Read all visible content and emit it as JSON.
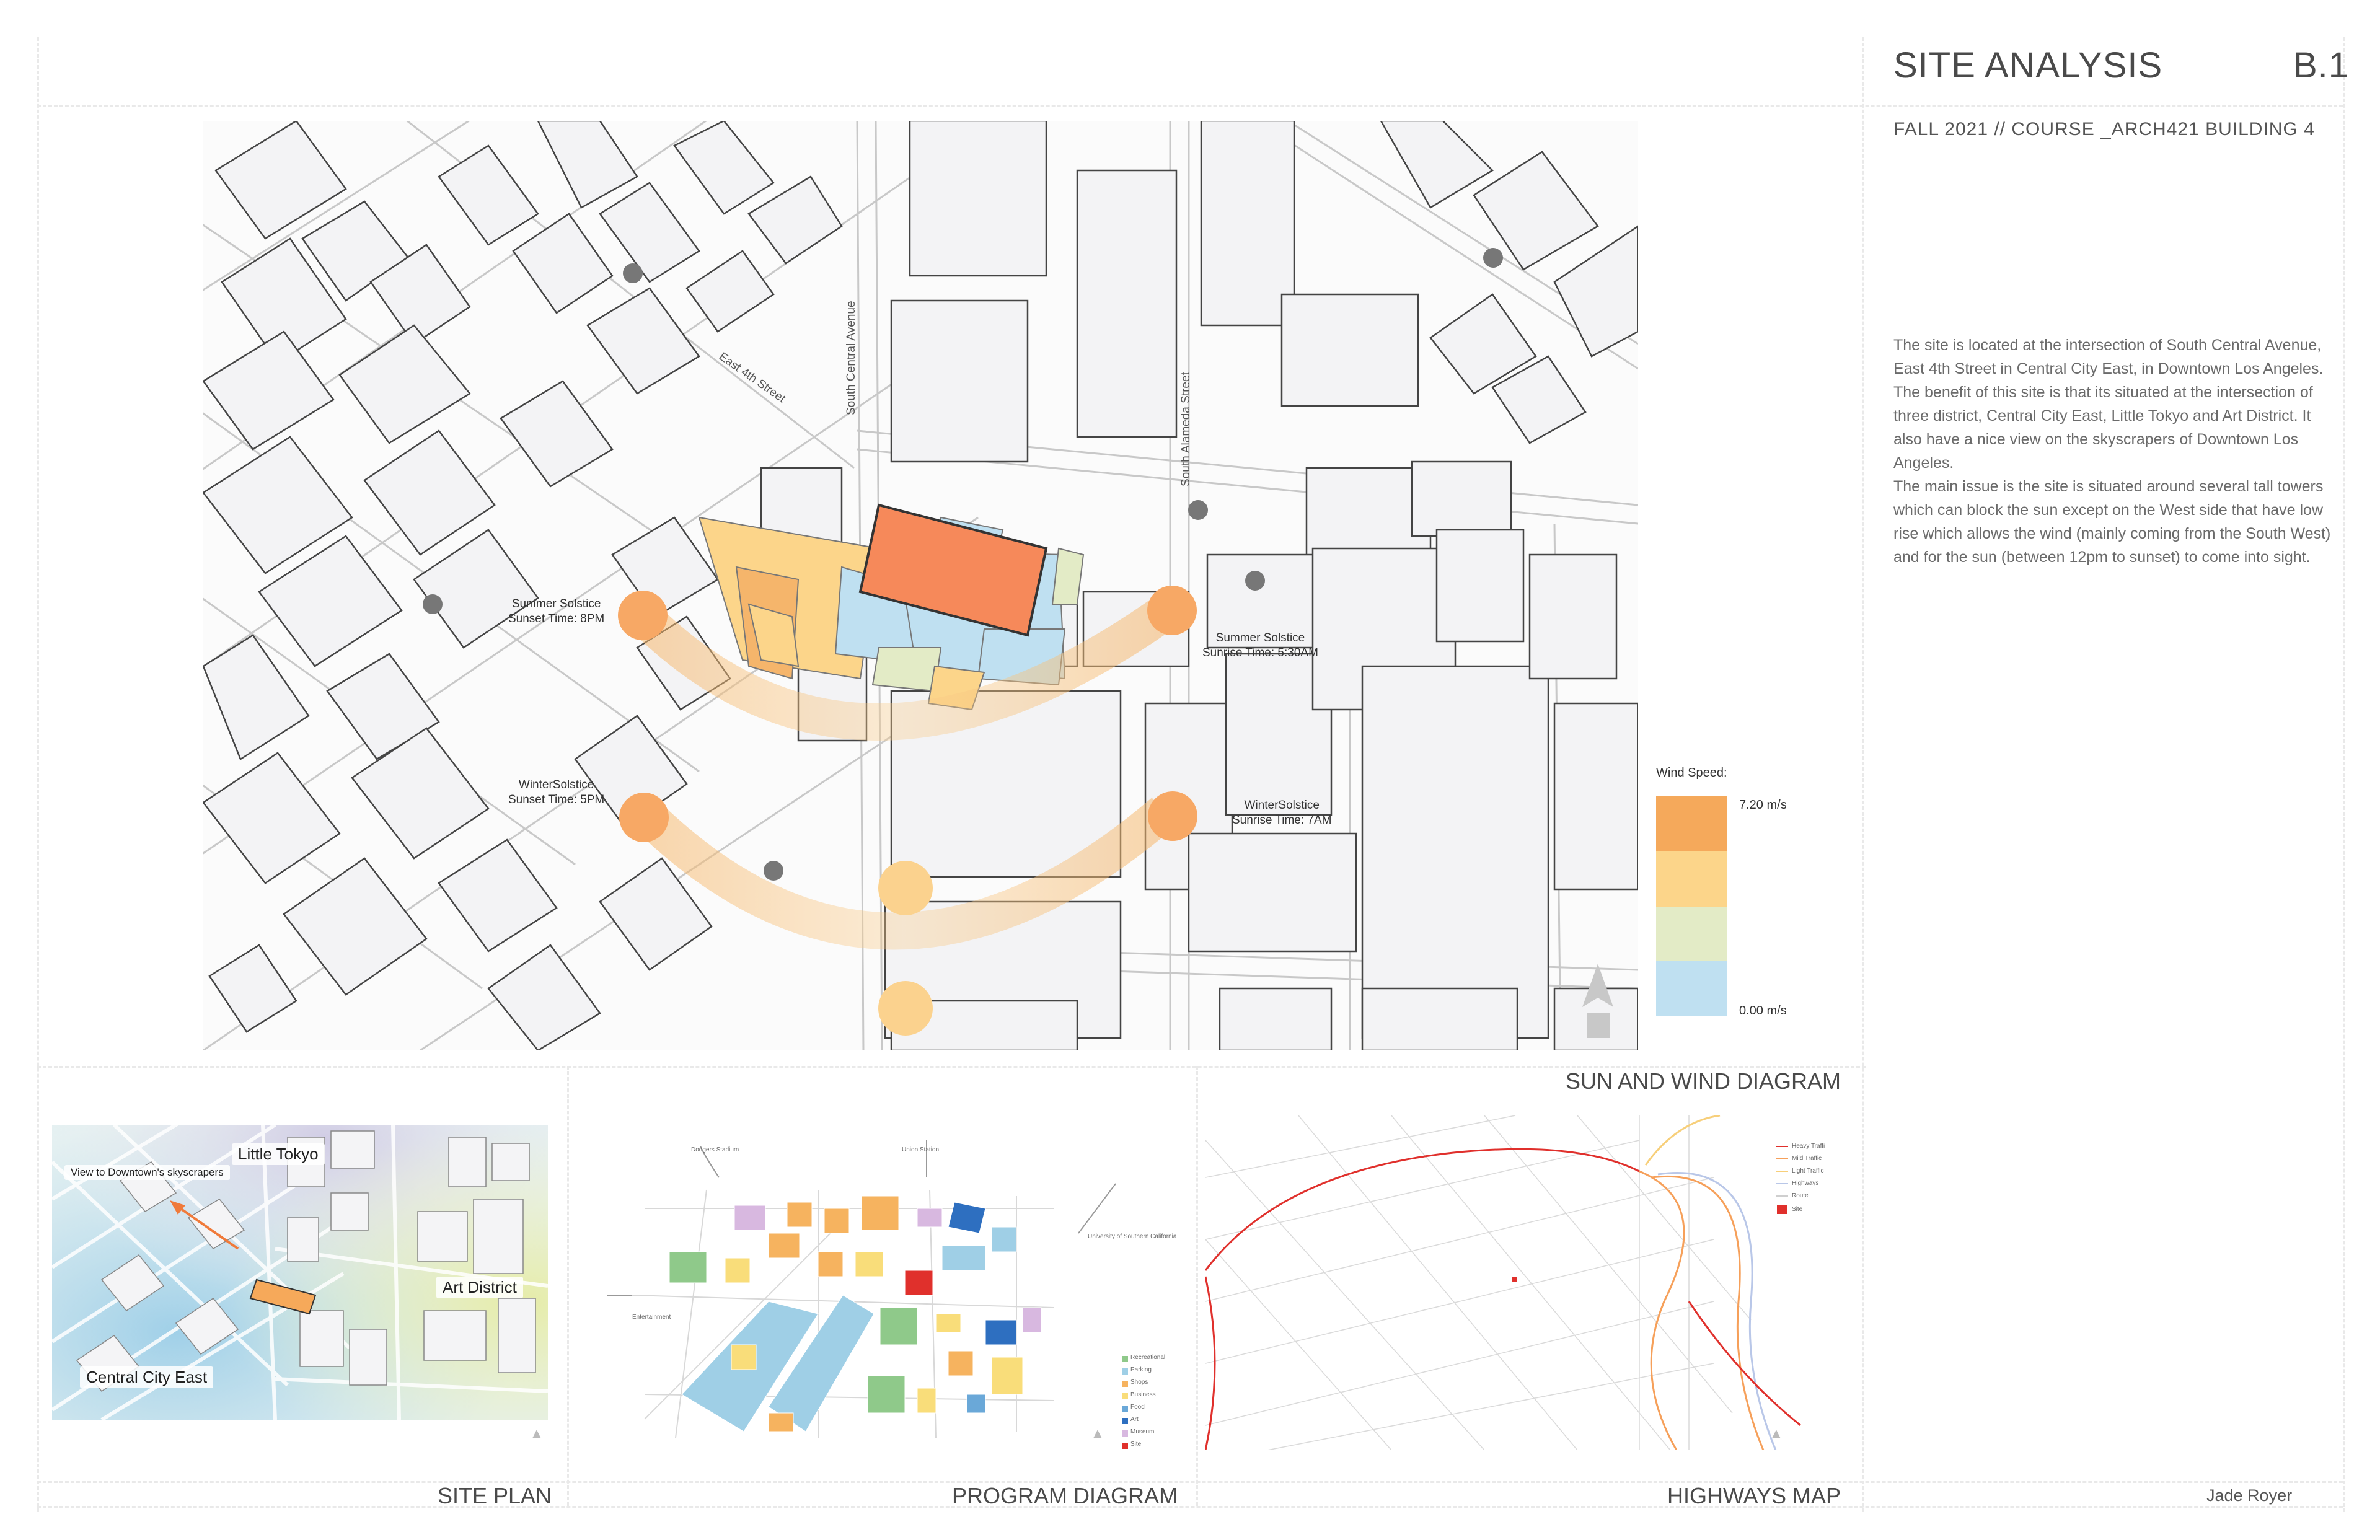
{
  "header": {
    "title": "SITE ANALYSIS",
    "sheet_code": "B.1",
    "course": "FALL 2021 // COURSE _ARCH421 BUILDING 4"
  },
  "description": [
    "The site is located at the intersection of South Central Avenue, East 4th Street in Central City East, in Downtown Los Angeles.",
    "The benefit of this site is that its situated at the intersection of three district, Central City East, Little Tokyo and Art District. It also have a nice view on the skyscrapers of Downtown Los Angeles.",
    "The main issue is the site is situated around several tall towers which can block the sun except on the West side that have low rise which allows the wind (mainly coming from the South West) and for the sun (between 12pm to sunset) to come into sight."
  ],
  "main_map": {
    "label": "SUN AND WIND DIAGRAM",
    "streets": {
      "east_4th": "East 4th Street",
      "south_central": "South Central Avenue",
      "south_alameda": "South Alameda Street"
    },
    "sun_points": [
      {
        "line1": "Summer Solstice",
        "line2": "Sunset Time: 8PM"
      },
      {
        "line1": "Summer Solstice",
        "line2": "Sunrise Time: 5:30AM"
      },
      {
        "line1": "WinterSolstice",
        "line2": "Sunset Time: 5PM"
      },
      {
        "line1": "WinterSolstice",
        "line2": "Sunrise Time: 7AM"
      }
    ],
    "legend": {
      "title": "Wind Speed:",
      "max": "7.20 m/s",
      "min": "0.00 m/s",
      "colors": [
        "#f5a95b",
        "#fcd58a",
        "#e3ebc6",
        "#bfe0f1"
      ]
    }
  },
  "site_plan": {
    "label": "SITE PLAN",
    "districts": [
      "Little Tokyo",
      "Art District",
      "Central City East"
    ],
    "view_note": "View to Downtown's skyscrapers"
  },
  "program_diagram": {
    "label": "PROGRAM DIAGRAM",
    "arrows": [
      "Dodgers Stadium",
      "Union Station",
      "University of Southern California",
      "Entertainment"
    ],
    "legend": [
      {
        "name": "Recreational",
        "color": "#8fc98a"
      },
      {
        "name": "Parking",
        "color": "#9fcfe6"
      },
      {
        "name": "Shops",
        "color": "#f6b35f"
      },
      {
        "name": "Business",
        "color": "#f9dd7a"
      },
      {
        "name": "Food",
        "color": "#6aa8d8"
      },
      {
        "name": "Art",
        "color": "#2e6fc0"
      },
      {
        "name": "Museum",
        "color": "#d8b8e0"
      },
      {
        "name": "Site",
        "color": "#e0302c"
      }
    ]
  },
  "highways_map": {
    "label": "HIGHWAYS MAP",
    "legend": [
      {
        "name": "Heavy Traffic",
        "color": "#e0302c"
      },
      {
        "name": "Mild Traffic",
        "color": "#f6a05a"
      },
      {
        "name": "Light Traffic",
        "color": "#f7cf7a"
      },
      {
        "name": "Highways",
        "color": "#b9c7e8"
      },
      {
        "name": "Route",
        "color": "#cfcfcf"
      },
      {
        "name": "Site",
        "color": "#e0302c"
      }
    ]
  },
  "footer": {
    "author": "Jade Royer"
  }
}
